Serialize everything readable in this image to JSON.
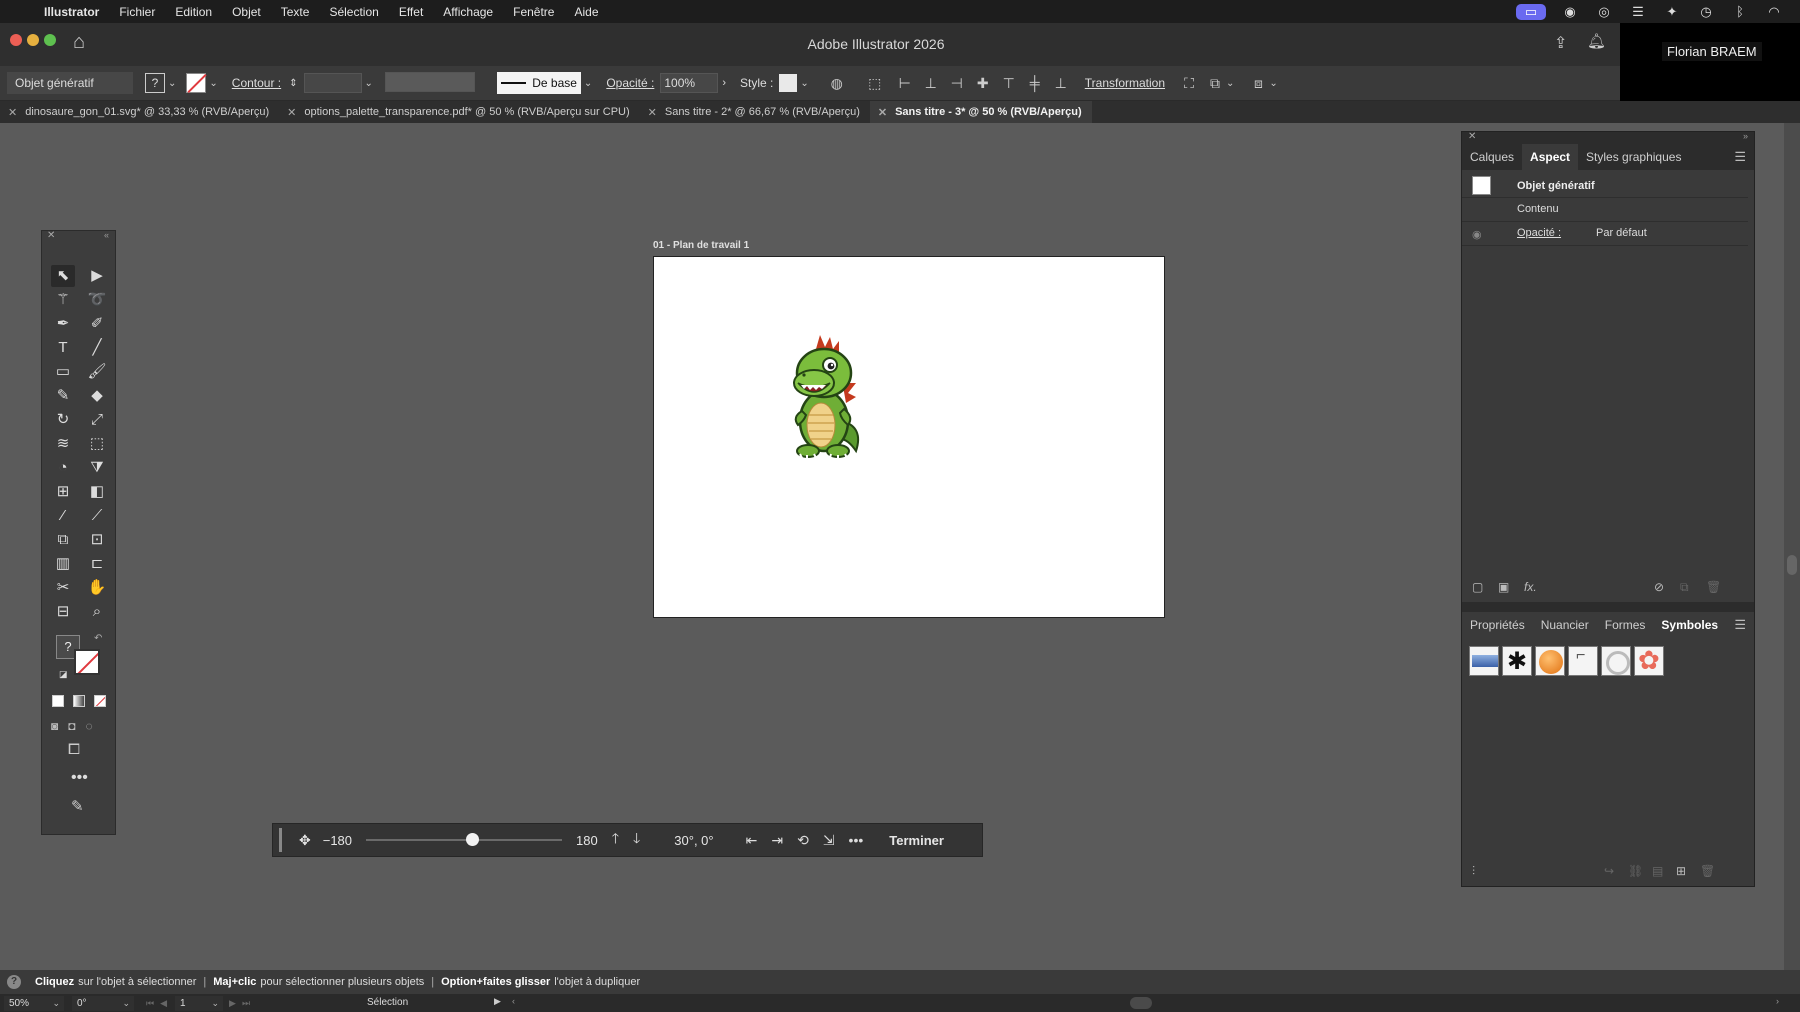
{
  "menubar": {
    "app": "Illustrator",
    "items": [
      "Fichier",
      "Edition",
      "Objet",
      "Texte",
      "Sélection",
      "Effet",
      "Affichage",
      "Fenêtre",
      "Aide"
    ],
    "status_icons": [
      "screen-share-icon",
      "messages-icon",
      "vpn-icon",
      "drive-icon",
      "sparkle-icon",
      "time-machine-icon",
      "bluetooth-icon",
      "wifi-icon"
    ]
  },
  "titlebar": {
    "title": "Adobe Illustrator 2026",
    "user": "Florian BRAEM"
  },
  "control": {
    "object_type": "Objet génératif",
    "fill_label": "?",
    "contour_label": "Contour :",
    "brush": "De base",
    "opacity_label": "Opacité :",
    "opacity_value": "100%",
    "style_label": "Style :",
    "transform_label": "Transformation"
  },
  "tabs": [
    {
      "label": "dinosaure_gon_01.svg* @ 33,33 % (RVB/Aperçu)",
      "active": false
    },
    {
      "label": "options_palette_transparence.pdf* @ 50 % (RVB/Aperçu sur CPU)",
      "active": false
    },
    {
      "label": "Sans titre - 2* @ 66,67 % (RVB/Aperçu)",
      "active": false
    },
    {
      "label": "Sans titre - 3* @ 50 % (RVB/Aperçu)",
      "active": true
    }
  ],
  "artboard": {
    "label": "01 - Plan de travail 1"
  },
  "aspect_panel": {
    "tabs": [
      "Calques",
      "Aspect",
      "Styles graphiques"
    ],
    "active_tab": "Aspect",
    "title": "Objet génératif",
    "content_label": "Contenu",
    "opacity_label": "Opacité :",
    "opacity_value": "Par défaut"
  },
  "bottom_panel": {
    "tabs": [
      "Propriétés",
      "Nuancier",
      "Formes",
      "Symboles"
    ],
    "active_tab": "Symboles"
  },
  "rotate_bar": {
    "min": "−180",
    "max": "180",
    "angle": "30°, 0°",
    "done": "Terminer",
    "slider_fraction": 0.54
  },
  "hint": {
    "part1_bold": "Cliquez",
    "part1": "sur l'objet à sélectionner",
    "part2_bold": "Maj+clic",
    "part2": "pour sélectionner plusieurs objets",
    "part3_bold": "Option+faites glisser",
    "part3": "l'objet à dupliquer"
  },
  "status": {
    "zoom": "50%",
    "rotation": "0°",
    "artboard_number": "1",
    "current_tool": "Sélection"
  },
  "colors": {
    "accent": "#6a6af0",
    "canvas": "#5b5b5b",
    "panel": "#3a3a3a"
  }
}
